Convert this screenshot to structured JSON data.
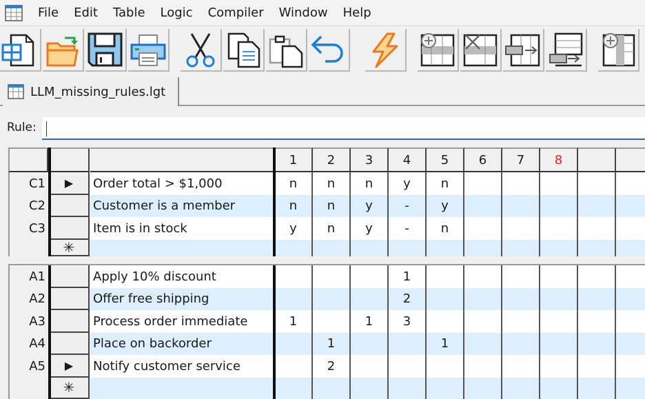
{
  "window": {
    "menu": [
      "File",
      "Edit",
      "Table",
      "Logic",
      "Compiler",
      "Window",
      "Help"
    ],
    "app_icon": "table-grid-icon"
  },
  "toolbar": {
    "buttons": [
      {
        "name": "new-table",
        "icon": "new-table-icon"
      },
      {
        "name": "open",
        "icon": "open-folder-icon"
      },
      {
        "name": "save",
        "icon": "floppy-disk-icon"
      },
      {
        "name": "print",
        "icon": "printer-icon"
      },
      {
        "name": "cut",
        "icon": "scissors-icon"
      },
      {
        "name": "copy",
        "icon": "copy-icon"
      },
      {
        "name": "paste",
        "icon": "paste-icon"
      },
      {
        "name": "undo",
        "icon": "undo-arrow-icon"
      },
      {
        "name": "compile",
        "icon": "lightning-icon"
      },
      {
        "name": "insert-row",
        "icon": "insert-row-icon"
      },
      {
        "name": "delete-row",
        "icon": "delete-row-icon"
      },
      {
        "name": "move-row",
        "icon": "move-row-icon"
      },
      {
        "name": "append-row",
        "icon": "append-row-icon"
      },
      {
        "name": "insert-column",
        "icon": "insert-column-icon"
      }
    ]
  },
  "tab": {
    "label": "LLM_missing_rules.lgt",
    "icon": "table-file-icon"
  },
  "rule": {
    "label": "Rule:",
    "value": ""
  },
  "grid": {
    "rule_numbers": [
      "1",
      "2",
      "3",
      "4",
      "5",
      "6",
      "7",
      "8"
    ],
    "highlighted_rule": "8",
    "highlight_color": "#ff1a1a",
    "conditions": [
      {
        "id": "C1",
        "text": "Order total > $1,000",
        "current": true,
        "values": [
          "n",
          "n",
          "n",
          "y",
          "n",
          "",
          "",
          ""
        ]
      },
      {
        "id": "C2",
        "text": "Customer is a member",
        "current": false,
        "values": [
          "n",
          "n",
          "y",
          "-",
          "y",
          "",
          "",
          ""
        ]
      },
      {
        "id": "C3",
        "text": "Item is in stock",
        "current": false,
        "values": [
          "y",
          "n",
          "y",
          "-",
          "n",
          "",
          "",
          ""
        ]
      }
    ],
    "actions": [
      {
        "id": "A1",
        "text": "Apply 10% discount",
        "current": false,
        "values": [
          "",
          "",
          "",
          "1",
          "",
          "",
          "",
          ""
        ]
      },
      {
        "id": "A2",
        "text": "Offer free shipping",
        "current": false,
        "values": [
          "",
          "",
          "",
          "2",
          "",
          "",
          "",
          ""
        ]
      },
      {
        "id": "A3",
        "text": "Process order immediate",
        "current": false,
        "values": [
          "1",
          "",
          "1",
          "3",
          "",
          "",
          "",
          ""
        ]
      },
      {
        "id": "A4",
        "text": "Place on backorder",
        "current": false,
        "values": [
          "",
          "1",
          "",
          "",
          "1",
          "",
          "",
          ""
        ]
      },
      {
        "id": "A5",
        "text": "Notify customer service",
        "current": true,
        "values": [
          "",
          "2",
          "",
          "",
          "",
          "",
          "",
          ""
        ]
      }
    ],
    "new_row_marker": "✳",
    "current_row_marker": "▶"
  }
}
